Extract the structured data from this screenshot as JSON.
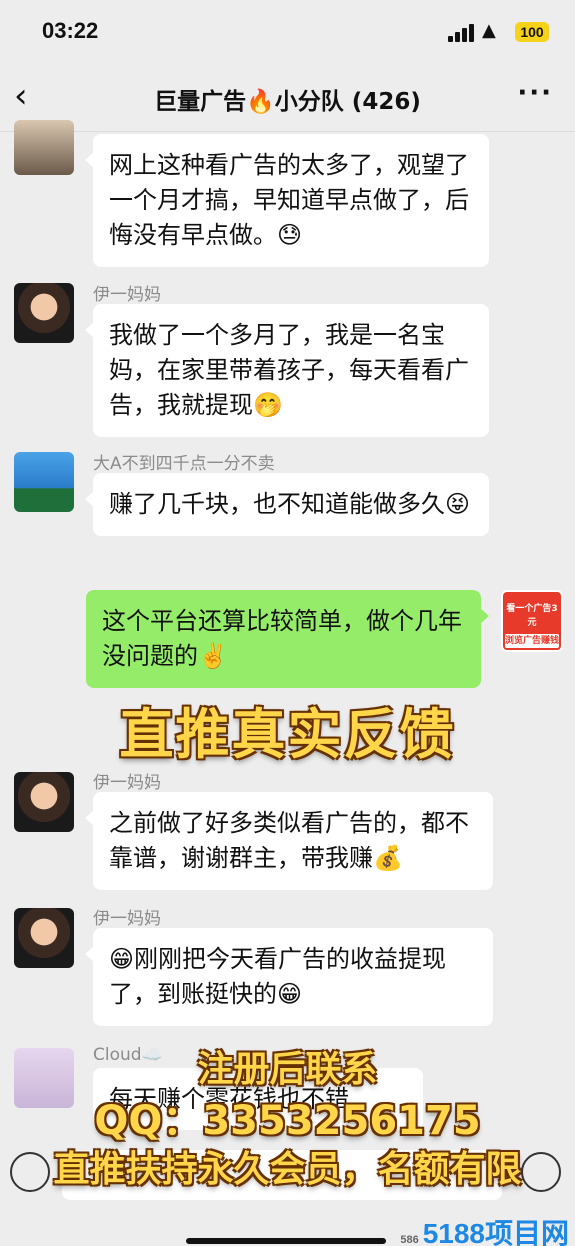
{
  "status": {
    "time": "03:22",
    "battery": "100"
  },
  "nav": {
    "back": "‹",
    "title": "巨量广告🔥小分队 (426)",
    "more": "···"
  },
  "messages": [
    {
      "sender": "",
      "text": "网上这种看广告的太多了，观望了一个月才搞，早知道早点做了，后悔没有早点做。😓"
    },
    {
      "sender": "伊一妈妈",
      "text": "我做了一个多月了，我是一名宝妈，在家里带着孩子，每天看看广告，我就提现🤭"
    },
    {
      "sender": "大A不到四千点一分不卖",
      "text": "赚了几千块，也不知道能做多久😝"
    },
    {
      "sender": "",
      "text": "这个平台还算比较简单，做个几年没问题的✌️"
    },
    {
      "sender": "伊一妈妈",
      "text": "之前做了好多类似看广告的，都不靠谱，谢谢群主，带我赚💰"
    },
    {
      "sender": "伊一妈妈",
      "text": "😁刚刚把今天看广告的收益提现了，到账挺快的😁"
    },
    {
      "sender": "Cloud☁️",
      "text": "每天赚个零花钱也不错"
    }
  ],
  "my_avatar": {
    "line1": "看一个广告3元",
    "line2": "浏览广告赚钱"
  },
  "overlay": {
    "headline": "直推真实反馈",
    "line1": "注册后联系",
    "line2": "QQ：3353256175",
    "line3": "直推扶持永久会员，名额有限"
  },
  "watermark": {
    "small": "586",
    "brand": "5188项目网"
  }
}
